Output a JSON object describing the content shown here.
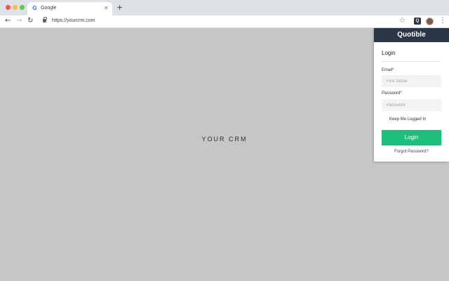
{
  "browser": {
    "tab": {
      "favicon": "G",
      "title": "Google",
      "close": "×"
    },
    "new_tab": "+",
    "nav": {
      "back": "←",
      "forward": "→",
      "reload": "↻"
    },
    "url": "https://yourcrm.com",
    "bookmark_star": "☆",
    "extension_label": "Q",
    "menu": "⋮"
  },
  "page": {
    "text": "YOUR CRM"
  },
  "popup": {
    "brand": "Quotible",
    "title": "Login",
    "email_label": "Email*",
    "email_placeholder": "First Name",
    "password_label": "Password*",
    "password_placeholder": "Password",
    "keep_logged_in": "Keep Me Logged In",
    "login_button": "Login",
    "forgot_password": "Forgot Password?"
  },
  "colors": {
    "page_background": "#c6c5c8",
    "popup_header": "#2b3747",
    "login_button": "#1fbf7b"
  }
}
